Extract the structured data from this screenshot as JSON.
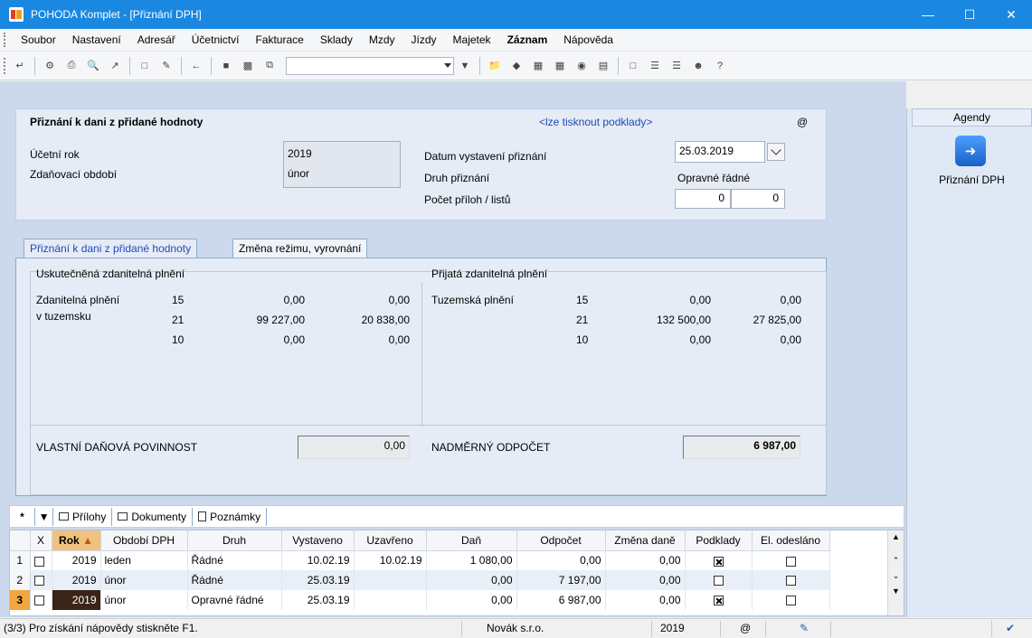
{
  "window": {
    "title": "POHODA Komplet - [Přiznání DPH]"
  },
  "menu": [
    "Soubor",
    "Nastavení",
    "Adresář",
    "Účetnictví",
    "Fakturace",
    "Sklady",
    "Mzdy",
    "Jízdy",
    "Majetek",
    "Záznam",
    "Nápověda"
  ],
  "header": {
    "title": "Přiznání k dani z přidané hodnoty",
    "print_link": "<lze tisknout podklady>",
    "at_symbol": "@",
    "ucetni_rok_label": "Účetní rok",
    "ucetni_rok_value": "2019",
    "obdobi_label": "Zdaňovací období",
    "obdobi_value": "únor",
    "datum_label": "Datum vystavení přiznání",
    "datum_value": "25.03.2019",
    "druh_label": "Druh přiznání",
    "druh_value": "Opravné řádné",
    "pocet_label": "Počet příloh / listů",
    "pocet_prilohy": "0",
    "pocet_listu": "0"
  },
  "tabs": [
    "Přiznání k dani z přidané hodnoty",
    "Změna režimu, vyrovnání"
  ],
  "uskutecnena": {
    "heading": "Uskutečněná zdanitelná plnění",
    "row_label_1": "Zdanitelná plnění",
    "row_label_2": "v tuzemsku",
    "rows": [
      {
        "rate": "15",
        "base": "0,00",
        "tax": "0,00"
      },
      {
        "rate": "21",
        "base": "99 227,00",
        "tax": "20 838,00"
      },
      {
        "rate": "10",
        "base": "0,00",
        "tax": "0,00"
      }
    ]
  },
  "prijata": {
    "heading": "Přijatá zdanitelná plnění",
    "row_label": "Tuzemská plnění",
    "rows": [
      {
        "rate": "15",
        "base": "0,00",
        "tax": "0,00"
      },
      {
        "rate": "21",
        "base": "132 500,00",
        "tax": "27 825,00"
      },
      {
        "rate": "10",
        "base": "0,00",
        "tax": "0,00"
      }
    ]
  },
  "totals": {
    "povinnost_label": "VLASTNÍ DAŇOVÁ POVINNOST",
    "povinnost_value": "0,00",
    "odpocet_label": "NADMĚRNÝ ODPOČET",
    "odpocet_value": "6 987,00"
  },
  "agenda": {
    "header": "Agendy",
    "label": "Přiznání DPH"
  },
  "bottom_tabs": [
    "Přílohy",
    "Dokumenty",
    "Poznámky"
  ],
  "grid": {
    "columns": [
      "X",
      "Rok",
      "Období DPH",
      "Druh",
      "Vystaveno",
      "Uzavřeno",
      "Daň",
      "Odpočet",
      "Změna daně",
      "Podklady",
      "El. odesláno"
    ],
    "rows": [
      {
        "n": "1",
        "rok": "2019",
        "obdobi": "leden",
        "druh": "Řádné",
        "vystaveno": "10.02.19",
        "uzavreno": "10.02.19",
        "dan": "1 080,00",
        "odpocet": "0,00",
        "zmena": "0,00"
      },
      {
        "n": "2",
        "rok": "2019",
        "obdobi": "únor",
        "druh": "Řádné",
        "vystaveno": "25.03.19",
        "uzavreno": "",
        "dan": "0,00",
        "odpocet": "7 197,00",
        "zmena": "0,00"
      },
      {
        "n": "3",
        "rok": "2019",
        "obdobi": "únor",
        "druh": "Opravné řádné",
        "vystaveno": "25.03.19",
        "uzavreno": "",
        "dan": "0,00",
        "odpocet": "6 987,00",
        "zmena": "0,00"
      }
    ]
  },
  "status": {
    "help": "(3/3) Pro získání nápovědy stiskněte F1.",
    "company": "Novák s.r.o.",
    "year": "2019",
    "at": "@"
  }
}
